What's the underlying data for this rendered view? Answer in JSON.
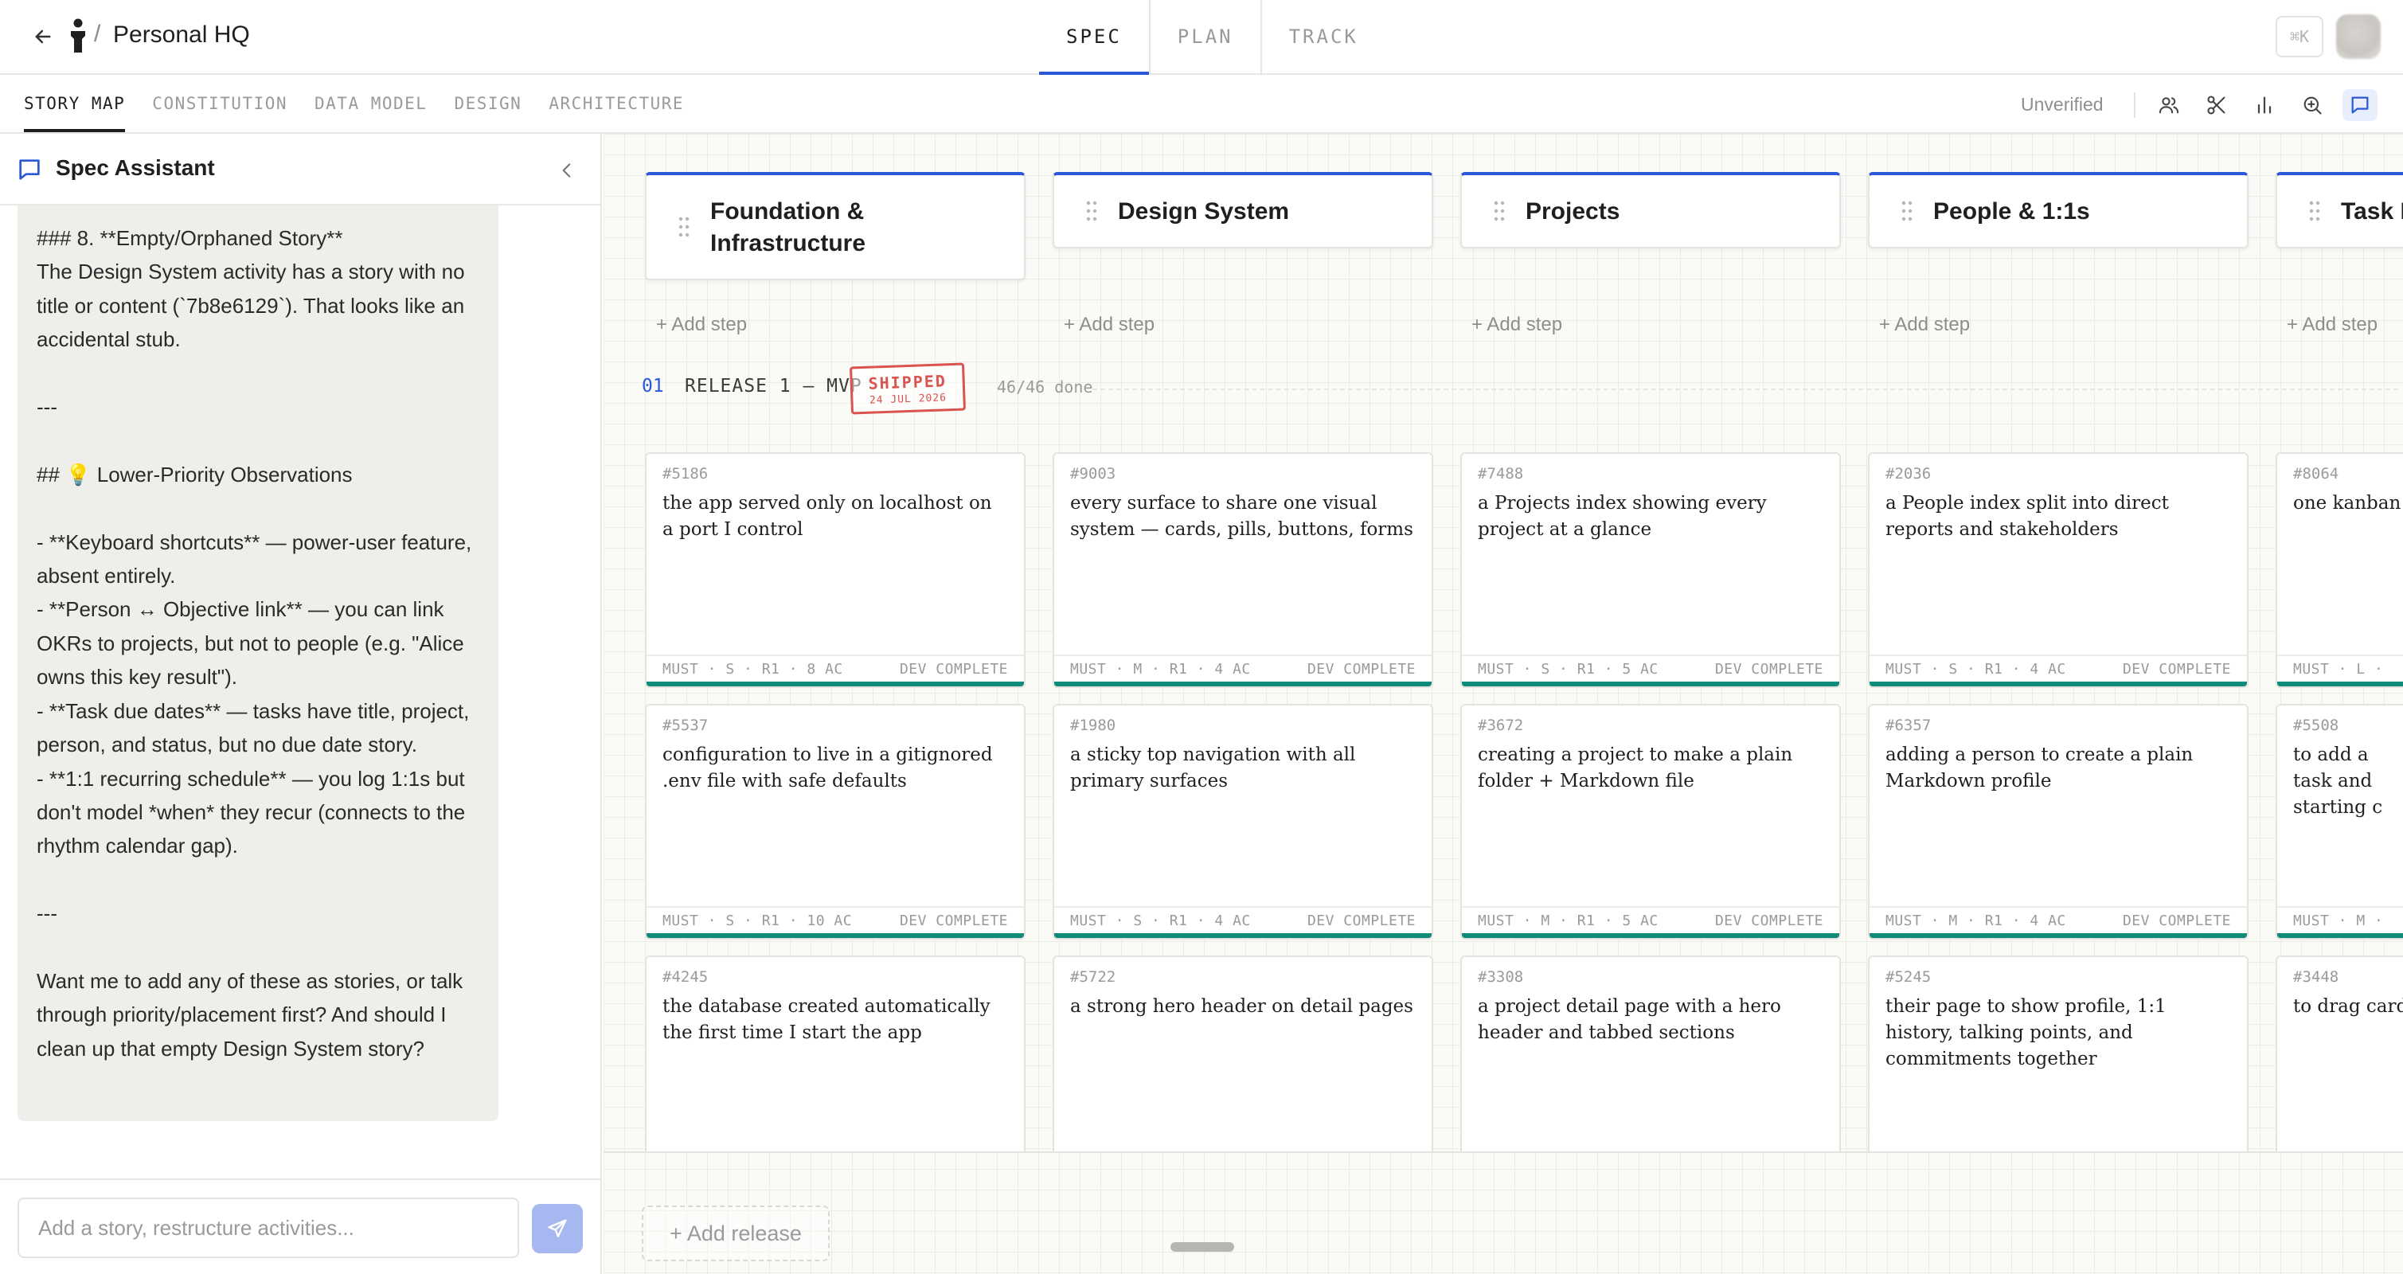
{
  "header": {
    "breadcrumb_separator": "/",
    "title": "Personal HQ",
    "tabs": [
      {
        "label": "SPEC",
        "active": true
      },
      {
        "label": "PLAN",
        "active": false
      },
      {
        "label": "TRACK",
        "active": false
      }
    ],
    "shortcut": "⌘K"
  },
  "subnav": {
    "tabs": [
      {
        "label": "STORY MAP",
        "active": true
      },
      {
        "label": "CONSTITUTION",
        "active": false
      },
      {
        "label": "DATA MODEL",
        "active": false
      },
      {
        "label": "DESIGN",
        "active": false
      },
      {
        "label": "ARCHITECTURE",
        "active": false
      }
    ],
    "status": "Unverified",
    "tools": [
      "people-icon",
      "scissors-icon",
      "bar-chart-icon",
      "zoom-icon",
      "chat-icon"
    ]
  },
  "assistant": {
    "title": "Spec Assistant",
    "message": "### 8. **Empty/Orphaned Story**\nThe Design System activity has a story with no title or content (`7b8e6129`). That looks like an accidental stub.\n\n---\n\n## 💡 Lower-Priority Observations\n\n- **Keyboard shortcuts** — power-user feature, absent entirely.\n- **Person ↔ Objective link** — you can link OKRs to projects, but not to people (e.g. \"Alice owns this key result\").\n- **Task due dates** — tasks have title, project, person, and status, but no due date story.\n- **1:1 recurring schedule** — you log 1:1s but don't model *when* they recur (connects to the rhythm calendar gap).\n\n---\n\nWant me to add any of these as stories, or talk through priority/placement first? And should I clean up that empty Design System story?",
    "input_placeholder": "Add a story, restructure activities...",
    "input_value": ""
  },
  "board": {
    "add_step_label": "+ Add step",
    "add_release_label": "+ Add release",
    "activities": [
      {
        "title": "Foundation & Infrastructure"
      },
      {
        "title": "Design System"
      },
      {
        "title": "Projects"
      },
      {
        "title": "People & 1:1s"
      },
      {
        "title": "Task B"
      }
    ],
    "release": {
      "number": "01",
      "name": "RELEASE 1 — MVP",
      "stamp": "SHIPPED",
      "stamp_date": "24 JUL 2026",
      "progress": "46/46 done"
    },
    "stories": [
      [
        {
          "id": "#5186",
          "title": "the app served only on localhost on a port I control",
          "meta": "MUST · S · R1 · 8 AC",
          "status": "DEV COMPLETE"
        },
        {
          "id": "#5537",
          "title": "configuration to live in a gitignored .env file with safe defaults",
          "meta": "MUST · S · R1 · 10 AC",
          "status": "DEV COMPLETE"
        },
        {
          "id": "#4245",
          "title": "the database created automatically the first time I start the app",
          "meta": "",
          "status": ""
        }
      ],
      [
        {
          "id": "#9003",
          "title": "every surface to share one visual system — cards, pills, buttons, forms",
          "meta": "MUST · M · R1 · 4 AC",
          "status": "DEV COMPLETE"
        },
        {
          "id": "#1980",
          "title": "a sticky top navigation with all primary surfaces",
          "meta": "MUST · S · R1 · 4 AC",
          "status": "DEV COMPLETE"
        },
        {
          "id": "#5722",
          "title": "a strong hero header on detail pages",
          "meta": "",
          "status": ""
        }
      ],
      [
        {
          "id": "#7488",
          "title": "a Projects index showing every project at a glance",
          "meta": "MUST · S · R1 · 5 AC",
          "status": "DEV COMPLETE"
        },
        {
          "id": "#3672",
          "title": "creating a project to make a plain folder + Markdown file",
          "meta": "MUST · M · R1 · 5 AC",
          "status": "DEV COMPLETE"
        },
        {
          "id": "#3308",
          "title": "a project detail page with a hero header and tabbed sections",
          "meta": "",
          "status": ""
        }
      ],
      [
        {
          "id": "#2036",
          "title": "a People index split into direct reports and stakeholders",
          "meta": "MUST · S · R1 · 4 AC",
          "status": "DEV COMPLETE"
        },
        {
          "id": "#6357",
          "title": "adding a person to create a plain Markdown profile",
          "meta": "MUST · M · R1 · 4 AC",
          "status": "DEV COMPLETE"
        },
        {
          "id": "#5245",
          "title": "their page to show profile, 1:1 history, talking points, and commitments together",
          "meta": "",
          "status": ""
        }
      ],
      [
        {
          "id": "#8064",
          "title": "one kanban b",
          "meta": "MUST · L ·",
          "status": ""
        },
        {
          "id": "#5508",
          "title": "to add a task and starting c",
          "meta": "MUST · M ·",
          "status": ""
        },
        {
          "id": "#3448",
          "title": "to drag cards",
          "meta": "",
          "status": ""
        }
      ]
    ]
  },
  "colors": {
    "accent": "#2a58d6",
    "done_bar": "#0f8a78",
    "stamp": "#d9534f",
    "send_button": "#a7b7ef"
  }
}
